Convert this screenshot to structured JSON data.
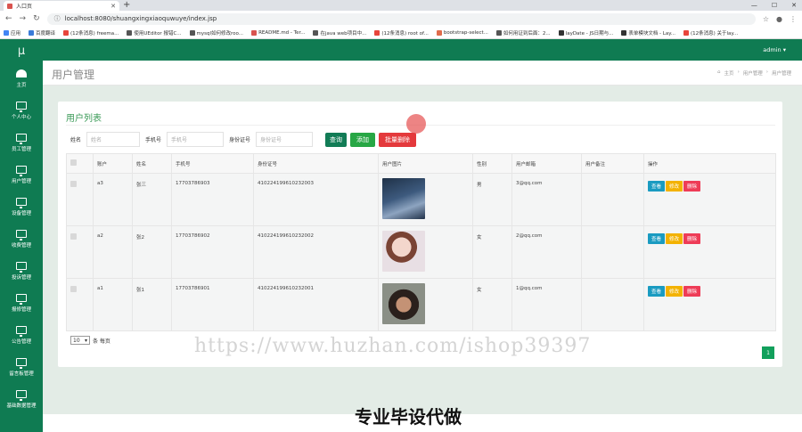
{
  "browser": {
    "tab_title": "入口页",
    "url": "localhost:8080/shuangxingxiaoquwuye/index.jsp",
    "bookmarks": [
      "应用",
      "百度翻译",
      "(12条消息) freema...",
      "使用UEditor 报错C...",
      "mysql如何修改roo...",
      "README.md - Ter...",
      "在java web项目中...",
      "(12条消息) root of...",
      "bootstrap-select...",
      "如何用证到后面：2...",
      "layDate - JS日期与...",
      "表单模块文档 - Lay...",
      "(12条消息) 关于lay..."
    ]
  },
  "sidebar": {
    "brand": "μ",
    "items": [
      {
        "label": "主页",
        "icon": "dashboard-icon"
      },
      {
        "label": "个人中心",
        "icon": "monitor-icon"
      },
      {
        "label": "员工管理",
        "icon": "monitor-icon"
      },
      {
        "label": "用户管理",
        "icon": "monitor-icon"
      },
      {
        "label": "设备管理",
        "icon": "monitor-icon"
      },
      {
        "label": "收费管理",
        "icon": "monitor-icon"
      },
      {
        "label": "投诉管理",
        "icon": "monitor-icon"
      },
      {
        "label": "报修管理",
        "icon": "monitor-icon"
      },
      {
        "label": "公告管理",
        "icon": "monitor-icon"
      },
      {
        "label": "留言板管理",
        "icon": "monitor-icon"
      },
      {
        "label": "基础数据管理",
        "icon": "monitor-icon"
      }
    ]
  },
  "topbar": {
    "user": "admin ▾"
  },
  "page": {
    "title": "用户管理",
    "breadcrumb": [
      "主页",
      "用户管理",
      "用户管理"
    ]
  },
  "card": {
    "title": "用户列表"
  },
  "filters": {
    "name_label": "姓名",
    "name_placeholder": "姓名",
    "phone_label": "手机号",
    "phone_placeholder": "手机号",
    "id_label": "身份证号",
    "id_placeholder": "身份证号",
    "search": "查询",
    "add": "添加",
    "batch_delete": "批量删除"
  },
  "table": {
    "headers": [
      "",
      "账户",
      "姓名",
      "手机号",
      "身份证号",
      "用户图片",
      "性别",
      "用户邮箱",
      "用户备注",
      "操作"
    ],
    "rows": [
      {
        "account": "a3",
        "name": "张三",
        "phone": "17703786903",
        "id": "410224199610232003",
        "gender": "男",
        "email": "3@qq.com",
        "note": ""
      },
      {
        "account": "a2",
        "name": "张2",
        "phone": "17703786902",
        "id": "410224199610232002",
        "gender": "女",
        "email": "2@qq.com",
        "note": ""
      },
      {
        "account": "a1",
        "name": "张1",
        "phone": "17703786901",
        "id": "410224199610232001",
        "gender": "女",
        "email": "1@qq.com",
        "note": ""
      }
    ],
    "actions": {
      "view": "查看",
      "edit": "修改",
      "delete": "删除"
    }
  },
  "pager": {
    "page_size": "10",
    "per_page_label": "条 每页",
    "current_page": "1"
  },
  "overlay": {
    "watermark": "https://www.huzhan.com/ishop39397",
    "caption": "专业毕设代做"
  }
}
